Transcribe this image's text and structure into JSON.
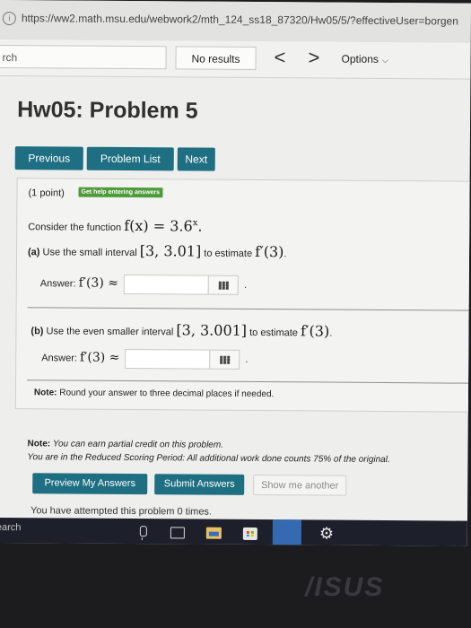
{
  "browser": {
    "url": "https://ww2.math.msu.edu/webwork2/mth_124_ss18_87320/Hw05/5/?effectiveUser=borgen"
  },
  "findbar": {
    "search_text": "rch",
    "status": "No results",
    "prev_symbol": "<",
    "next_symbol": ">",
    "options_label": "Options"
  },
  "page": {
    "title": "Hw05: Problem 5"
  },
  "nav": {
    "previous": "Previous",
    "problem_list": "Problem List",
    "next": "Next"
  },
  "problem": {
    "points": "(1 point)",
    "help_badge": "Get help entering answers",
    "consider_text": "Consider the function",
    "function_expr": "f(x) = 3.6",
    "function_exp": "x",
    "function_end": ".",
    "part_a_label": "(a)",
    "part_a_text": "Use the small interval",
    "part_a_interval": "[3, 3.01]",
    "part_a_mid": "to estimate",
    "derivative_expr": "f′(3)",
    "period": ".",
    "answer_label": "Answer:",
    "answer_expr": "f′(3) ≈",
    "part_b_label": "(b)",
    "part_b_text": "Use the even smaller interval",
    "part_b_interval": "[3, 3.001]",
    "part_b_mid": "to estimate",
    "note_label": "Note:",
    "note_text": "Round your answer to three decimal places if needed."
  },
  "notes": {
    "label": "Note:",
    "partial_credit": "You can earn partial credit on this problem.",
    "reduced_scoring": "You are in the Reduced Scoring Period: All additional work done counts 75% of the original."
  },
  "submit": {
    "preview": "Preview My Answers",
    "submit": "Submit Answers",
    "show_another": "Show me another"
  },
  "attempts_text": "You have attempted this problem 0 times.",
  "taskbar": {
    "search_label": "earch"
  },
  "bezel": {
    "logo": "/ISUS"
  },
  "icons": {
    "info": "info-icon",
    "grid": "grid-icon",
    "mic": "mic-icon",
    "task_view": "task-view-icon",
    "explorer": "file-explorer-icon",
    "store": "store-icon",
    "settings": "gear-icon"
  },
  "colors": {
    "button": "#1f6f83",
    "help_badge": "#4f9a3b",
    "taskbar": "#1d1f2b"
  }
}
